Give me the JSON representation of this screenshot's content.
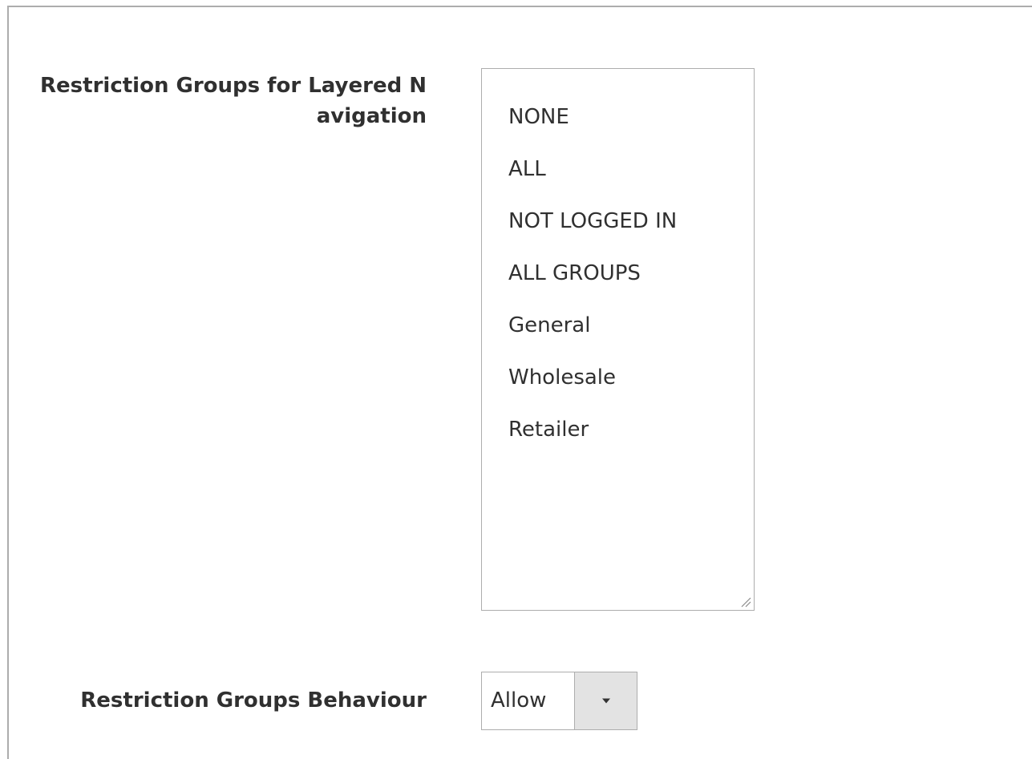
{
  "fields": {
    "restriction_groups": {
      "label_line1": "Restriction Groups for Layered N",
      "label_line2": "avigation",
      "options": [
        "NONE",
        "ALL",
        "NOT LOGGED IN",
        "ALL GROUPS",
        "General",
        "Wholesale",
        "Retailer"
      ]
    },
    "restriction_behaviour": {
      "label": "Restriction Groups Behaviour",
      "selected": "Allow"
    }
  },
  "colors": {
    "border": "#adadad",
    "text": "#303030",
    "arrow_bg": "#e3e3e3"
  },
  "icons": {
    "dropdown": "triangle-down-icon",
    "resize": "resize-grip-icon"
  }
}
